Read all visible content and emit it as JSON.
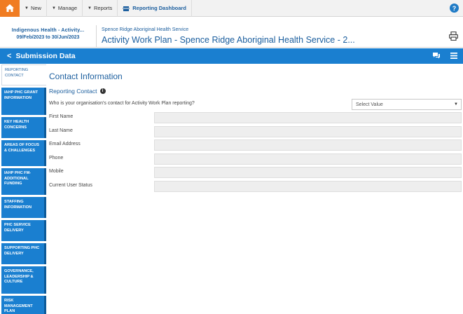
{
  "topbar": {
    "menu": [
      {
        "label": "New"
      },
      {
        "label": "Manage"
      },
      {
        "label": "Reports"
      }
    ],
    "dashboard_label": "Reporting Dashboard"
  },
  "header": {
    "org": "Indigenous Health - Activity...",
    "dates": "09/Feb/2023 to 30/Jun/2023",
    "service": "Spence Ridge Aboriginal Health Service",
    "title": "Activity Work Plan - Spence Ridge Aboriginal Health Service - 2..."
  },
  "bluebar": {
    "back_label": "Submission Data"
  },
  "sidebar": {
    "items": [
      {
        "label": "Reporting Contact"
      },
      {
        "label": "IAHP PHC Grant Information"
      },
      {
        "label": "Key Health Concerns"
      },
      {
        "label": "Areas of Focus & Challenges"
      },
      {
        "label": "IAHP PHC FM- Additional Funding"
      },
      {
        "label": "Staffing Information"
      },
      {
        "label": "PHC Service Delivery"
      },
      {
        "label": "Supporting PHC Delivery"
      },
      {
        "label": "Governance, Leadership & Culture"
      },
      {
        "label": "Risk Management Plan"
      }
    ]
  },
  "main": {
    "section_title": "Contact Information",
    "subsection_title": "Reporting Contact",
    "question": "Who is your organisation's contact for Activity Work Plan reporting?",
    "select_value": "Select Value",
    "fields": [
      {
        "label": "First Name",
        "value": ""
      },
      {
        "label": "Last Name",
        "value": ""
      },
      {
        "label": "Email Address",
        "value": ""
      },
      {
        "label": "Phone",
        "value": ""
      },
      {
        "label": "Mobile",
        "value": ""
      },
      {
        "label": "Current User Status",
        "value": ""
      }
    ]
  },
  "colors": {
    "accent_blue": "#1a7fd0",
    "title_blue": "#1b5e9e",
    "home_orange": "#f07c22"
  }
}
